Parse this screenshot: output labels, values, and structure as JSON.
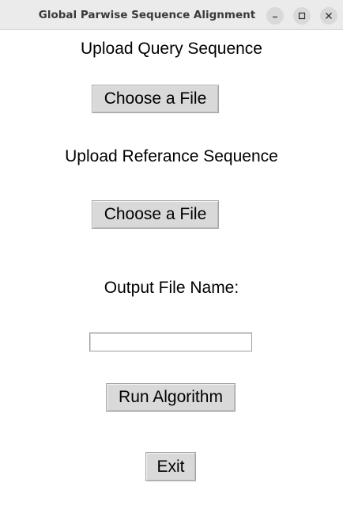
{
  "window": {
    "title": "Global Parwise Sequence Alignment",
    "controls": {
      "minimize_icon": "minimize-icon",
      "maximize_icon": "maximize-icon",
      "close_icon": "close-icon"
    }
  },
  "query": {
    "label": "Upload Query Sequence",
    "button_label": "Choose a File"
  },
  "reference": {
    "label": "Upload Referance Sequence",
    "button_label": "Choose a File"
  },
  "output": {
    "label": "Output File Name:",
    "value": ""
  },
  "actions": {
    "run_label": "Run Algorithm",
    "exit_label": "Exit"
  }
}
